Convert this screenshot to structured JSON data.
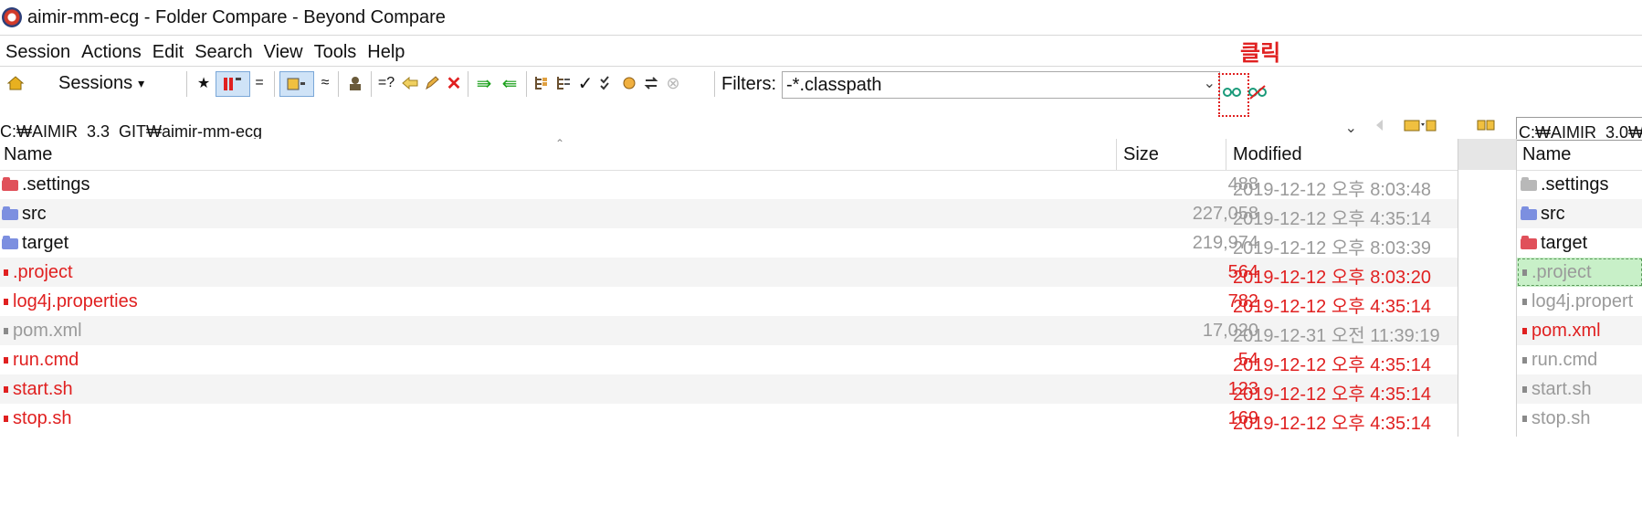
{
  "window": {
    "title": "aimir-mm-ecg - Folder Compare - Beyond Compare"
  },
  "menu": [
    "Session",
    "Actions",
    "Edit",
    "Search",
    "View",
    "Tools",
    "Help"
  ],
  "annotation": "클릭",
  "toolbar": {
    "sessions_label": "Sessions",
    "sessions_arrow": "▾",
    "filters_label": "Filters:",
    "filter_value": "-*.classpath",
    "glyphs": {
      "all": "★",
      "equal": "=",
      "similar": "≈",
      "compare_contents": "=?",
      "delete": "✕",
      "copy_right": "⇛",
      "copy_left": "⇚",
      "check": "✓",
      "stop": "⊗"
    }
  },
  "left": {
    "path": "C:₩AIMIR_3.3_GIT₩aimir-mm-ecg",
    "headers": {
      "name": "Name",
      "size": "Size",
      "modified": "Modified"
    },
    "rows": [
      {
        "icon": "folder-red-icon",
        "name": ".settings",
        "size": "488",
        "modified": "2019-12-12 오후 8:03:48",
        "tone": "gray"
      },
      {
        "icon": "folder-blue-icon",
        "name": "src",
        "size": "227,058",
        "modified": "2019-12-12 오후 4:35:14",
        "tone": "gray"
      },
      {
        "icon": "folder-blue-icon",
        "name": "target",
        "size": "219,974",
        "modified": "2019-12-12 오후 8:03:39",
        "tone": "gray"
      },
      {
        "icon": "file-red-icon",
        "name": ".project",
        "size": "564",
        "modified": "2019-12-12 오후 8:03:20",
        "tone": "red"
      },
      {
        "icon": "file-red-icon",
        "name": "log4j.properties",
        "size": "782",
        "modified": "2019-12-12 오후 4:35:14",
        "tone": "red"
      },
      {
        "icon": "file-gray-icon",
        "name": "pom.xml",
        "size": "17,020",
        "modified": "2019-12-31 오전 11:39:19",
        "tone": "gray"
      },
      {
        "icon": "file-red-icon",
        "name": "run.cmd",
        "size": "54",
        "modified": "2019-12-12 오후 4:35:14",
        "tone": "red"
      },
      {
        "icon": "file-red-icon",
        "name": "start.sh",
        "size": "123",
        "modified": "2019-12-12 오후 4:35:14",
        "tone": "red"
      },
      {
        "icon": "file-red-icon",
        "name": "stop.sh",
        "size": "169",
        "modified": "2019-12-12 오후 4:35:14",
        "tone": "red"
      }
    ]
  },
  "right": {
    "path": "C:₩AIMIR_3.0₩",
    "headers": {
      "name": "Name"
    },
    "rows": [
      {
        "icon": "folder-gray-icon",
        "name": ".settings",
        "tone": "dark"
      },
      {
        "icon": "folder-blue-icon",
        "name": "src",
        "tone": "dark"
      },
      {
        "icon": "folder-red-icon",
        "name": "target",
        "tone": "dark"
      },
      {
        "icon": "file-gray-icon",
        "name": ".project",
        "tone": "gray"
      },
      {
        "icon": "file-gray-icon",
        "name": "log4j.propert",
        "tone": "gray"
      },
      {
        "icon": "file-red-icon",
        "name": "pom.xml",
        "tone": "red"
      },
      {
        "icon": "file-gray-icon",
        "name": "run.cmd",
        "tone": "gray"
      },
      {
        "icon": "file-gray-icon",
        "name": "start.sh",
        "tone": "gray"
      },
      {
        "icon": "file-gray-icon",
        "name": "stop.sh",
        "tone": "gray"
      }
    ]
  },
  "colors": {
    "red": "#e02020",
    "gray": "#9a9a9a",
    "selection_green": "#c8f0c8"
  }
}
